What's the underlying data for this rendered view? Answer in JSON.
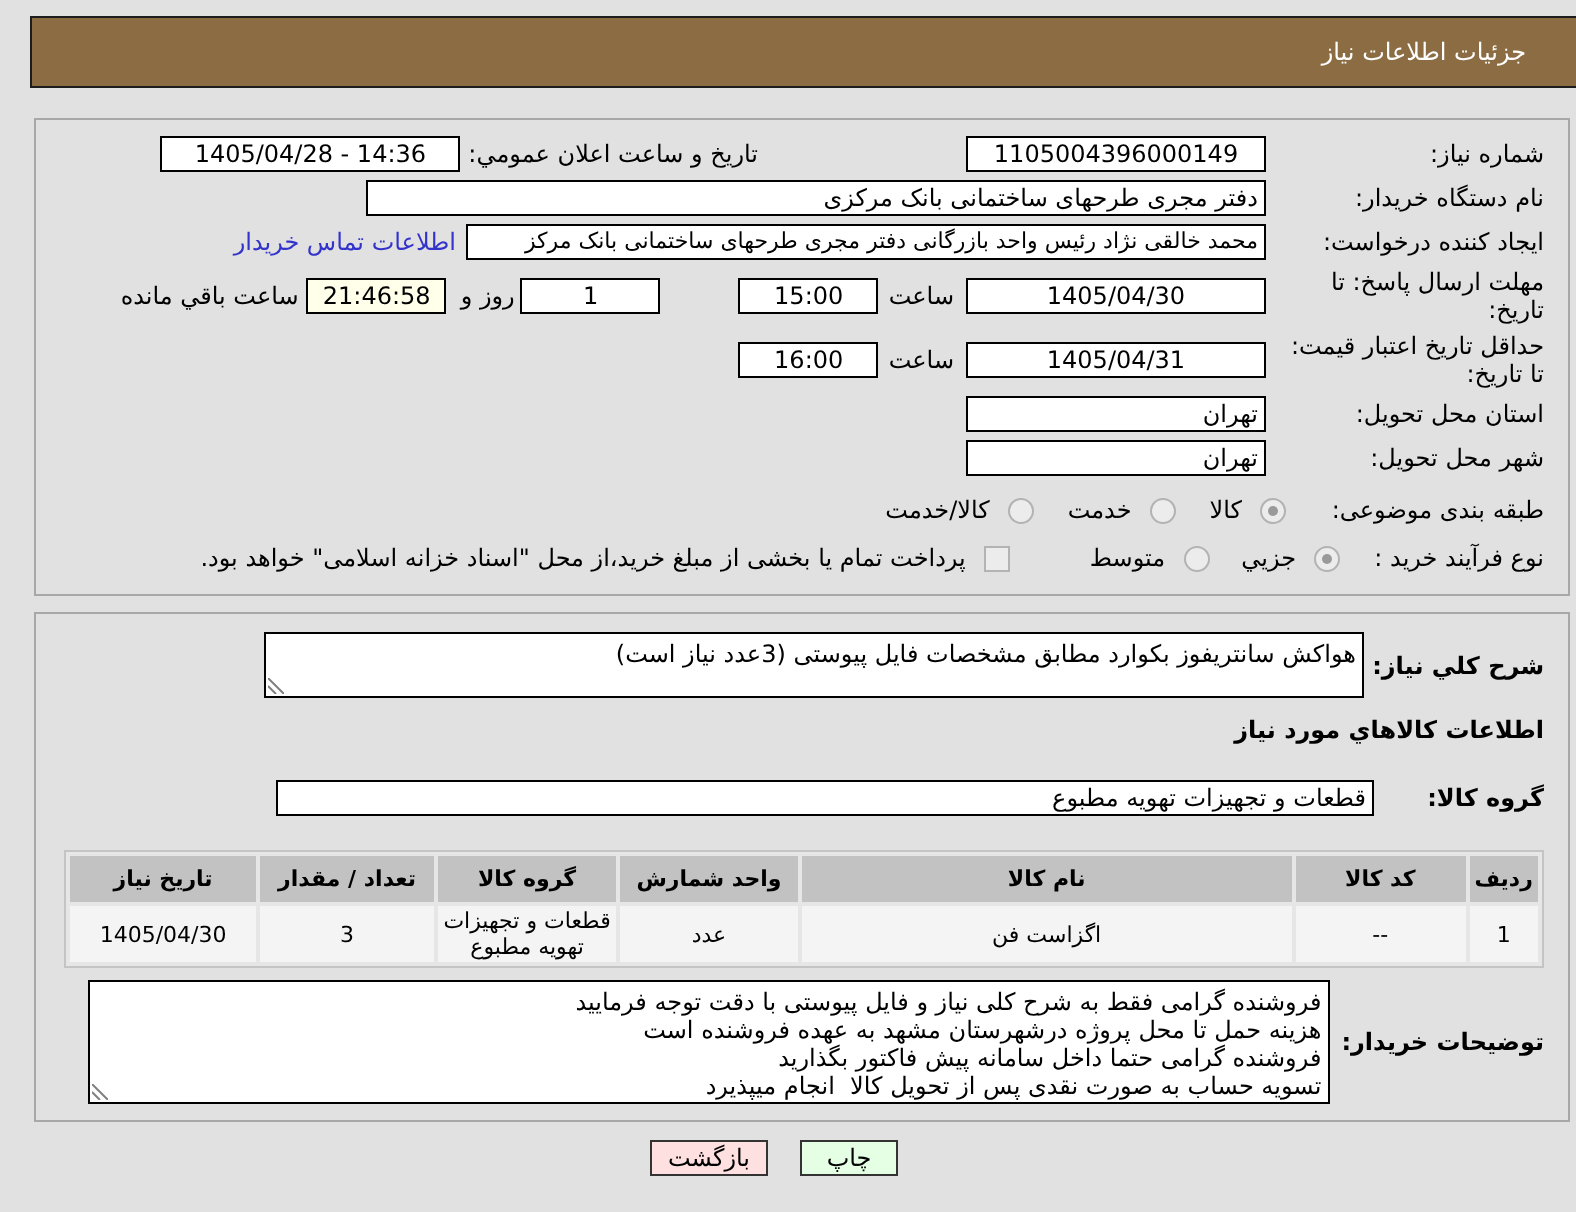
{
  "header": {
    "title": "جزئیات اطلاعات نیاز"
  },
  "details": {
    "need_number": {
      "label": "شماره نیاز:",
      "value": "1105004396000149"
    },
    "announcement": {
      "label": "تاریخ و ساعت اعلان عمومي:",
      "value": "1405/04/28 - 14:36"
    },
    "buyer_org": {
      "label": "نام دستگاه خریدار:",
      "value": "دفتر مجری طرحهای ساختمانی بانک مرکزی"
    },
    "requester": {
      "label": "ایجاد کننده درخواست:",
      "value": "محمد خالقی نژاد رئیس واحد بازرگانی دفتر مجری طرحهای ساختمانی بانک مرکز",
      "link": "اطلاعات تماس خریدار"
    },
    "reply_deadline": {
      "label": "مهلت ارسال پاسخ: تا تاریخ:",
      "date": "1405/04/30",
      "time_label": "ساعت",
      "time": "15:00",
      "days": "1",
      "days_label": "روز و",
      "remaining": "21:46:58",
      "remaining_label": "ساعت باقي مانده"
    },
    "price_validity": {
      "label": "حداقل تاریخ اعتبار قیمت: تا تاریخ:",
      "date": "1405/04/31",
      "time_label": "ساعت",
      "time": "16:00"
    },
    "province": {
      "label": "استان محل تحویل:",
      "value": "تهران"
    },
    "city": {
      "label": "شهر محل تحویل:",
      "value": "تهران"
    },
    "category": {
      "label": "طبقه بندی موضوعی:",
      "options": [
        {
          "label": "کالا",
          "selected": true
        },
        {
          "label": "خدمت",
          "selected": false
        },
        {
          "label": "کالا/خدمت",
          "selected": false
        }
      ]
    },
    "purchase_process": {
      "label": "نوع فرآیند خرید :",
      "options": [
        {
          "label": "جزيي",
          "selected": true
        },
        {
          "label": "متوسط",
          "selected": false
        }
      ],
      "treasury_payment": {
        "label": "پرداخت تمام یا بخشی از مبلغ خرید،از محل \"اسناد خزانه اسلامی\" خواهد بود.",
        "checked": false
      }
    }
  },
  "need": {
    "description": {
      "label": "شرح کلي نیاز:",
      "value": "هواکش سانتریفوز بکوارد مطابق مشخصات فایل پیوستی (3عدد نیاز است)"
    },
    "items_title": "اطلاعات کالاهاي مورد نياز",
    "goods_group": {
      "label": "گروه کالا:",
      "value": "قطعات و تجهیزات تهویه مطبوع"
    },
    "table": {
      "columns": [
        "ردیف",
        "کد کالا",
        "نام کالا",
        "واحد شمارش",
        "گروه کالا",
        "تعداد / مقدار",
        "تاریخ نیاز"
      ],
      "rows": [
        [
          "1",
          "--",
          "اگزاست فن",
          "عدد",
          "قطعات و تجهیزات تهویه مطبوع",
          "3",
          "1405/04/30"
        ]
      ]
    },
    "buyer_notes": {
      "label": "توضیحات خریدار:",
      "lines": [
        "فروشنده گرامی فقط به شرح کلی نیاز و فایل پیوستی با دقت توجه فرمایید",
        "هزینه حمل تا محل پروژه درشهرستان مشهد به عهده فروشنده است",
        "فروشنده گرامی حتما داخل سامانه پیش فاکتور بگذارید",
        "تسویه حساب به صورت نقدی پس از تحویل کالا  انجام میپذیرد"
      ]
    }
  },
  "buttons": [
    {
      "kind": "print",
      "label": "چاپ"
    },
    {
      "kind": "back",
      "label": "بازگشت"
    }
  ]
}
